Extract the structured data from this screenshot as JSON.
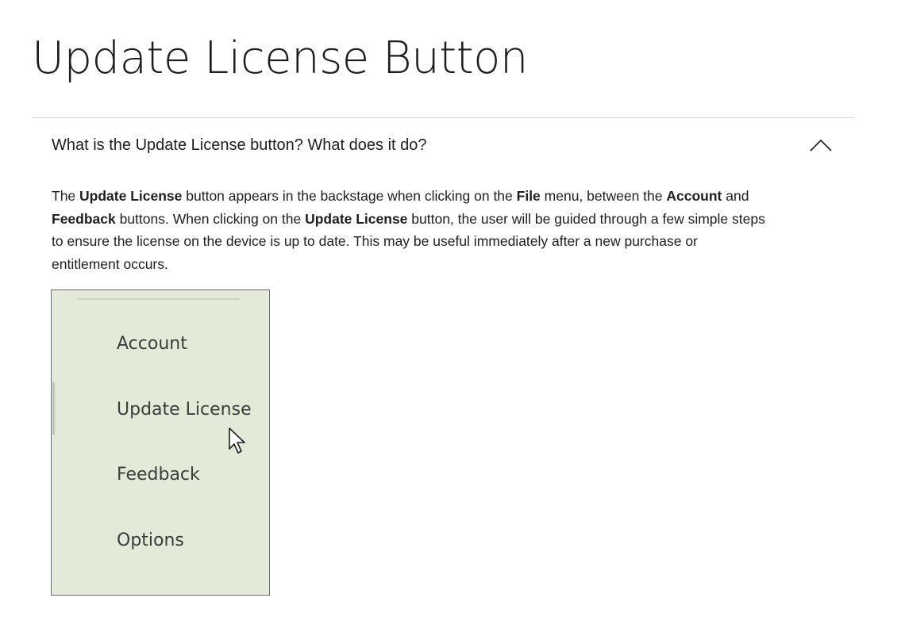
{
  "page": {
    "title": "Update License Button"
  },
  "accordion": {
    "question": "What is the Update License button?  What does it do?",
    "expanded": true,
    "toggle_icon": "chevron-up-icon"
  },
  "answer": {
    "segments": [
      {
        "text": "The ",
        "bold": false
      },
      {
        "text": "Update License",
        "bold": true
      },
      {
        "text": " button appears in the backstage when clicking on the ",
        "bold": false
      },
      {
        "text": "File",
        "bold": true
      },
      {
        "text": " menu, between the ",
        "bold": false
      },
      {
        "text": "Account",
        "bold": true
      },
      {
        "text": " and ",
        "bold": false
      },
      {
        "text": "Feedback",
        "bold": true
      },
      {
        "text": " buttons.  When clicking on the ",
        "bold": false
      },
      {
        "text": "Update License",
        "bold": true
      },
      {
        "text": " button, the user will be guided through a few simple steps to ensure the license on the device is up to date.  This may be useful immediately after a new purchase or entitlement occurs.",
        "bold": false
      }
    ]
  },
  "screenshot": {
    "menu_items": [
      {
        "label": "Account"
      },
      {
        "label": "Update License"
      },
      {
        "label": "Feedback"
      },
      {
        "label": "Options"
      }
    ],
    "background_color": "#e3ebd8",
    "cursor_icon": "mouse-pointer-icon"
  }
}
